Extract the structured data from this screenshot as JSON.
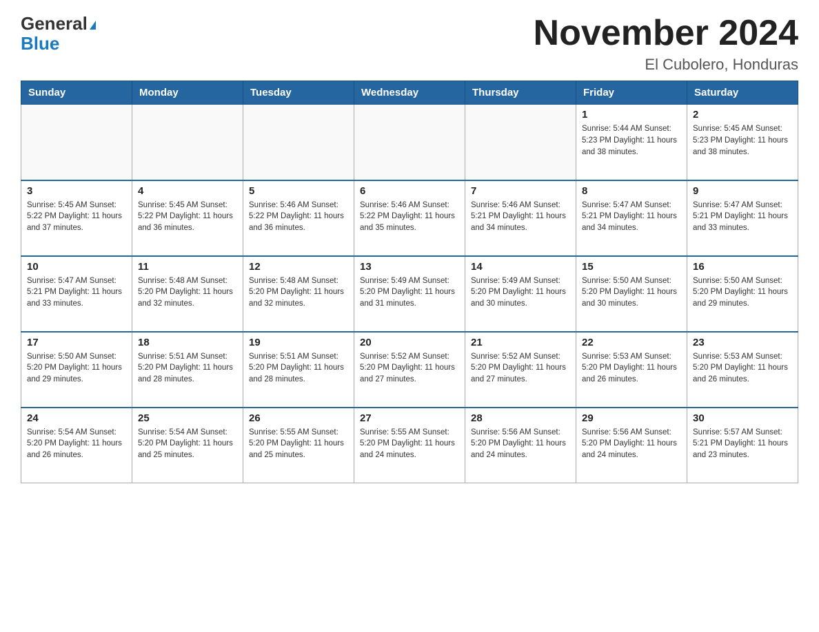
{
  "header": {
    "logo_general": "General",
    "logo_blue": "Blue",
    "title": "November 2024",
    "subtitle": "El Cubolero, Honduras"
  },
  "days_of_week": [
    "Sunday",
    "Monday",
    "Tuesday",
    "Wednesday",
    "Thursday",
    "Friday",
    "Saturday"
  ],
  "weeks": [
    [
      {
        "day": "",
        "info": ""
      },
      {
        "day": "",
        "info": ""
      },
      {
        "day": "",
        "info": ""
      },
      {
        "day": "",
        "info": ""
      },
      {
        "day": "",
        "info": ""
      },
      {
        "day": "1",
        "info": "Sunrise: 5:44 AM\nSunset: 5:23 PM\nDaylight: 11 hours and 38 minutes."
      },
      {
        "day": "2",
        "info": "Sunrise: 5:45 AM\nSunset: 5:23 PM\nDaylight: 11 hours and 38 minutes."
      }
    ],
    [
      {
        "day": "3",
        "info": "Sunrise: 5:45 AM\nSunset: 5:22 PM\nDaylight: 11 hours and 37 minutes."
      },
      {
        "day": "4",
        "info": "Sunrise: 5:45 AM\nSunset: 5:22 PM\nDaylight: 11 hours and 36 minutes."
      },
      {
        "day": "5",
        "info": "Sunrise: 5:46 AM\nSunset: 5:22 PM\nDaylight: 11 hours and 36 minutes."
      },
      {
        "day": "6",
        "info": "Sunrise: 5:46 AM\nSunset: 5:22 PM\nDaylight: 11 hours and 35 minutes."
      },
      {
        "day": "7",
        "info": "Sunrise: 5:46 AM\nSunset: 5:21 PM\nDaylight: 11 hours and 34 minutes."
      },
      {
        "day": "8",
        "info": "Sunrise: 5:47 AM\nSunset: 5:21 PM\nDaylight: 11 hours and 34 minutes."
      },
      {
        "day": "9",
        "info": "Sunrise: 5:47 AM\nSunset: 5:21 PM\nDaylight: 11 hours and 33 minutes."
      }
    ],
    [
      {
        "day": "10",
        "info": "Sunrise: 5:47 AM\nSunset: 5:21 PM\nDaylight: 11 hours and 33 minutes."
      },
      {
        "day": "11",
        "info": "Sunrise: 5:48 AM\nSunset: 5:20 PM\nDaylight: 11 hours and 32 minutes."
      },
      {
        "day": "12",
        "info": "Sunrise: 5:48 AM\nSunset: 5:20 PM\nDaylight: 11 hours and 32 minutes."
      },
      {
        "day": "13",
        "info": "Sunrise: 5:49 AM\nSunset: 5:20 PM\nDaylight: 11 hours and 31 minutes."
      },
      {
        "day": "14",
        "info": "Sunrise: 5:49 AM\nSunset: 5:20 PM\nDaylight: 11 hours and 30 minutes."
      },
      {
        "day": "15",
        "info": "Sunrise: 5:50 AM\nSunset: 5:20 PM\nDaylight: 11 hours and 30 minutes."
      },
      {
        "day": "16",
        "info": "Sunrise: 5:50 AM\nSunset: 5:20 PM\nDaylight: 11 hours and 29 minutes."
      }
    ],
    [
      {
        "day": "17",
        "info": "Sunrise: 5:50 AM\nSunset: 5:20 PM\nDaylight: 11 hours and 29 minutes."
      },
      {
        "day": "18",
        "info": "Sunrise: 5:51 AM\nSunset: 5:20 PM\nDaylight: 11 hours and 28 minutes."
      },
      {
        "day": "19",
        "info": "Sunrise: 5:51 AM\nSunset: 5:20 PM\nDaylight: 11 hours and 28 minutes."
      },
      {
        "day": "20",
        "info": "Sunrise: 5:52 AM\nSunset: 5:20 PM\nDaylight: 11 hours and 27 minutes."
      },
      {
        "day": "21",
        "info": "Sunrise: 5:52 AM\nSunset: 5:20 PM\nDaylight: 11 hours and 27 minutes."
      },
      {
        "day": "22",
        "info": "Sunrise: 5:53 AM\nSunset: 5:20 PM\nDaylight: 11 hours and 26 minutes."
      },
      {
        "day": "23",
        "info": "Sunrise: 5:53 AM\nSunset: 5:20 PM\nDaylight: 11 hours and 26 minutes."
      }
    ],
    [
      {
        "day": "24",
        "info": "Sunrise: 5:54 AM\nSunset: 5:20 PM\nDaylight: 11 hours and 26 minutes."
      },
      {
        "day": "25",
        "info": "Sunrise: 5:54 AM\nSunset: 5:20 PM\nDaylight: 11 hours and 25 minutes."
      },
      {
        "day": "26",
        "info": "Sunrise: 5:55 AM\nSunset: 5:20 PM\nDaylight: 11 hours and 25 minutes."
      },
      {
        "day": "27",
        "info": "Sunrise: 5:55 AM\nSunset: 5:20 PM\nDaylight: 11 hours and 24 minutes."
      },
      {
        "day": "28",
        "info": "Sunrise: 5:56 AM\nSunset: 5:20 PM\nDaylight: 11 hours and 24 minutes."
      },
      {
        "day": "29",
        "info": "Sunrise: 5:56 AM\nSunset: 5:20 PM\nDaylight: 11 hours and 24 minutes."
      },
      {
        "day": "30",
        "info": "Sunrise: 5:57 AM\nSunset: 5:21 PM\nDaylight: 11 hours and 23 minutes."
      }
    ]
  ]
}
